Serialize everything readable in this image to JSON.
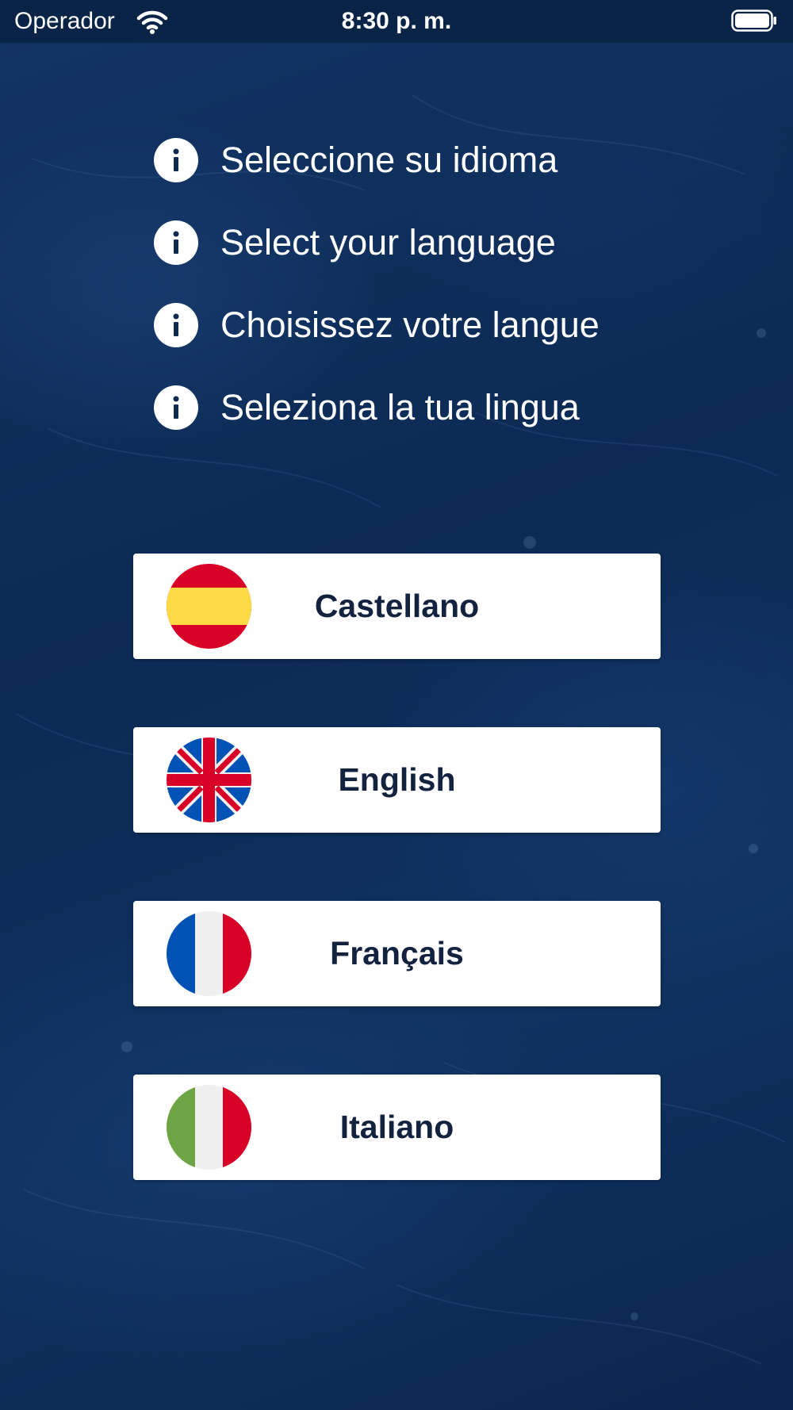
{
  "status_bar": {
    "carrier": "Operador",
    "time": "8:30 p. m."
  },
  "info_lines": [
    {
      "icon": "info-icon",
      "text": "Seleccione su idioma"
    },
    {
      "icon": "info-icon",
      "text": "Select your language"
    },
    {
      "icon": "info-icon",
      "text": "Choisissez votre langue"
    },
    {
      "icon": "info-icon",
      "text": "Seleziona la tua lingua"
    }
  ],
  "languages": [
    {
      "label": "Castellano",
      "flag": "spain-flag-icon"
    },
    {
      "label": "English",
      "flag": "uk-flag-icon"
    },
    {
      "label": "Français",
      "flag": "france-flag-icon"
    },
    {
      "label": "Italiano",
      "flag": "italy-flag-icon"
    }
  ],
  "colors": {
    "background": "#0d2a52",
    "status_bar": "#0a2447",
    "button_bg": "#ffffff",
    "button_text": "#13223f"
  }
}
